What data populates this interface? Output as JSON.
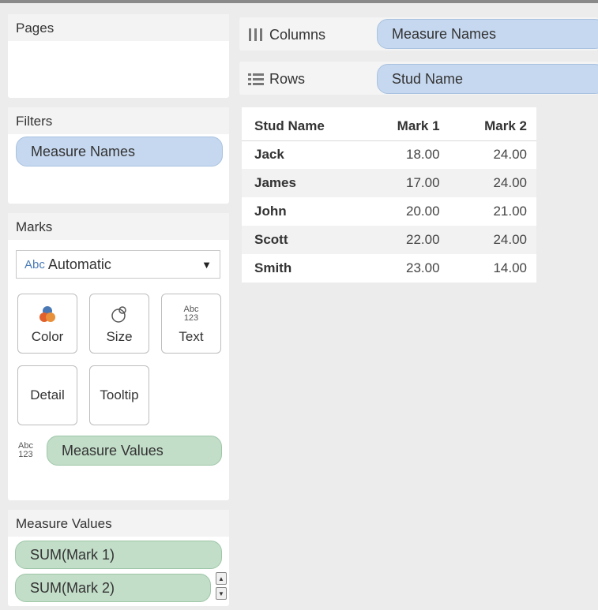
{
  "pages": {
    "title": "Pages"
  },
  "filters": {
    "title": "Filters",
    "pills": [
      "Measure Names"
    ]
  },
  "marks": {
    "title": "Marks",
    "type_icon": "Abc",
    "type": "Automatic",
    "buttons": {
      "color": "Color",
      "size": "Size",
      "text": "Text",
      "detail": "Detail",
      "tooltip": "Tooltip"
    },
    "text_icon_top": "Abc",
    "text_icon_bottom": "123",
    "field_pill": "Measure Values"
  },
  "measure_values": {
    "title": "Measure Values",
    "pills": [
      "SUM(Mark 1)",
      "SUM(Mark 2)"
    ]
  },
  "shelves": {
    "columns": {
      "label": "Columns",
      "pill": "Measure Names"
    },
    "rows": {
      "label": "Rows",
      "pill": "Stud Name"
    }
  },
  "table": {
    "headers": [
      "Stud Name",
      "Mark 1",
      "Mark 2"
    ],
    "rows": [
      [
        "Jack",
        "18.00",
        "24.00"
      ],
      [
        "James",
        "17.00",
        "24.00"
      ],
      [
        "John",
        "20.00",
        "21.00"
      ],
      [
        "Scott",
        "22.00",
        "24.00"
      ],
      [
        "Smith",
        "23.00",
        "14.00"
      ]
    ]
  },
  "colors": {
    "blue_pill": "#c6d8ef",
    "green_pill": "#c2ddc8",
    "background": "#ececec"
  }
}
